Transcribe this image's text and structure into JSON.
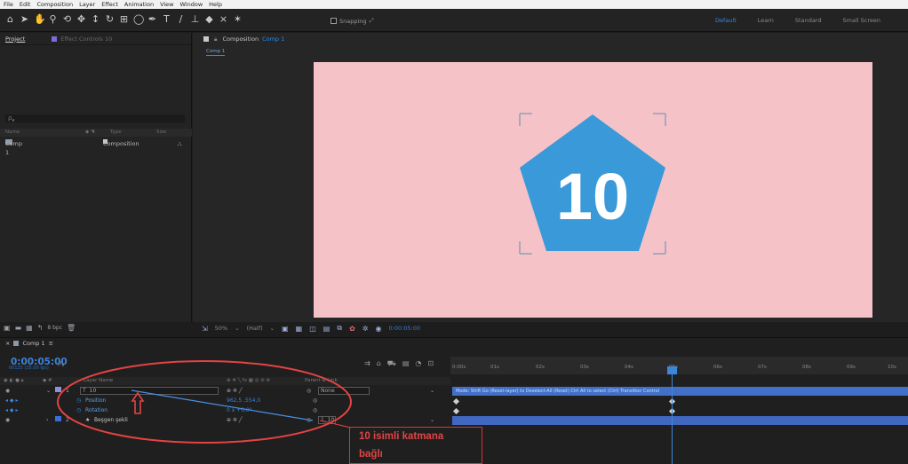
{
  "menu": [
    "File",
    "Edit",
    "Composition",
    "Layer",
    "Effect",
    "Animation",
    "View",
    "Window",
    "Help"
  ],
  "toolbar": {
    "snapping_label": "Snapping",
    "workspaces": [
      "Default",
      "Learn",
      "Standard",
      "Small Screen"
    ]
  },
  "project_panel": {
    "tab_project": "Project",
    "tab_effect": "Effect Controls 10",
    "columns": {
      "name": "Name",
      "type": "Type",
      "size": "Size"
    },
    "items": [
      {
        "name": "Comp 1",
        "type": "Composition"
      }
    ],
    "footer_bpc": "8 bpc"
  },
  "comp_panel": {
    "tab_label": "Composition",
    "tab_name": "Comp 1",
    "breadcrumb": "Comp 1",
    "shape_text": "10",
    "zoom": "50%",
    "resolution": "(Half)",
    "timecode": "0:00:05:00"
  },
  "timeline": {
    "tab": "Comp 1",
    "timecode": "0:00:05:00",
    "frames": "00125 (25.00 fps)",
    "layer_name_header": "Layer Name",
    "parent_header": "Parent & Link",
    "ruler_ticks": [
      "0:00s",
      "01s",
      "02s",
      "03s",
      "04s",
      "05s",
      "06s",
      "07s",
      "08s",
      "09s",
      "10s"
    ],
    "layers": [
      {
        "index": "1",
        "name": "10",
        "parent": "None",
        "track_text": "Mode: Shift Go (Reset-layer) to Deselect-All (Reset) Ctrl All to select (Ctrl) Transition Control"
      },
      {
        "index": "2",
        "name": "Beşgen şekli",
        "parent": "1. 10"
      }
    ],
    "props": [
      {
        "name": "Position",
        "value": "962,5 ,554,0"
      },
      {
        "name": "Rotation",
        "value": "0 x +0,0°"
      }
    ]
  },
  "annotation": {
    "line1": "10 isimli katmana",
    "line2": "bağlı"
  },
  "colors": {
    "accent": "#2d8ceb",
    "viewer_bg": "#f5c3c7",
    "pentagon": "#3a9ad9",
    "annotation": "#e34343"
  }
}
